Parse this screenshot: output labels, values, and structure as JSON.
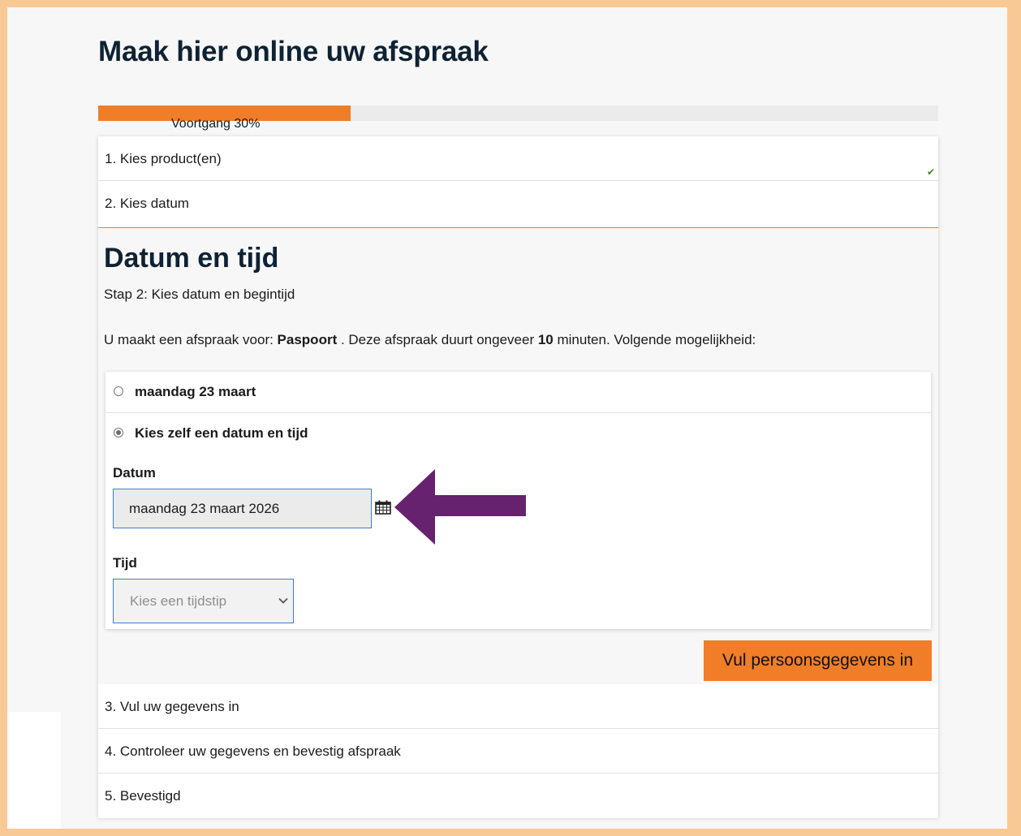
{
  "page_title": "Maak hier online uw afspraak",
  "progress": {
    "value_percent": 30,
    "label": "Voortgang 30%",
    "color": "#f07d27"
  },
  "steps": [
    {
      "label": "1. Kies product(en)",
      "completed": true,
      "check_icon": "✔"
    },
    {
      "label": "2. Kies datum",
      "active": true
    },
    {
      "label": "3. Vul uw gegevens in"
    },
    {
      "label": "4. Controleer uw gegevens en bevestig afspraak"
    },
    {
      "label": "5. Bevestigd"
    }
  ],
  "step2": {
    "title": "Datum en tijd",
    "subtitle": "Stap 2: Kies datum en begintijd",
    "info_prefix": "U maakt een afspraak voor: ",
    "product": "Paspoort",
    "info_middle": " . Deze afspraak duurt ongeveer ",
    "duration": "10",
    "info_suffix": " minuten. Volgende mogelijkheid:",
    "options": [
      {
        "label": "maandag 23 maart",
        "selected": false
      },
      {
        "label": "Kies zelf een datum en tijd",
        "selected": true
      }
    ],
    "date_label": "Datum",
    "date_value": "maandag 23 maart 2026",
    "time_label": "Tijd",
    "time_placeholder": "Kies een tijdstip",
    "next_button": "Vul persoonsgegevens in"
  },
  "annotation": {
    "icon": "arrow-left-icon",
    "color": "#66226e"
  }
}
